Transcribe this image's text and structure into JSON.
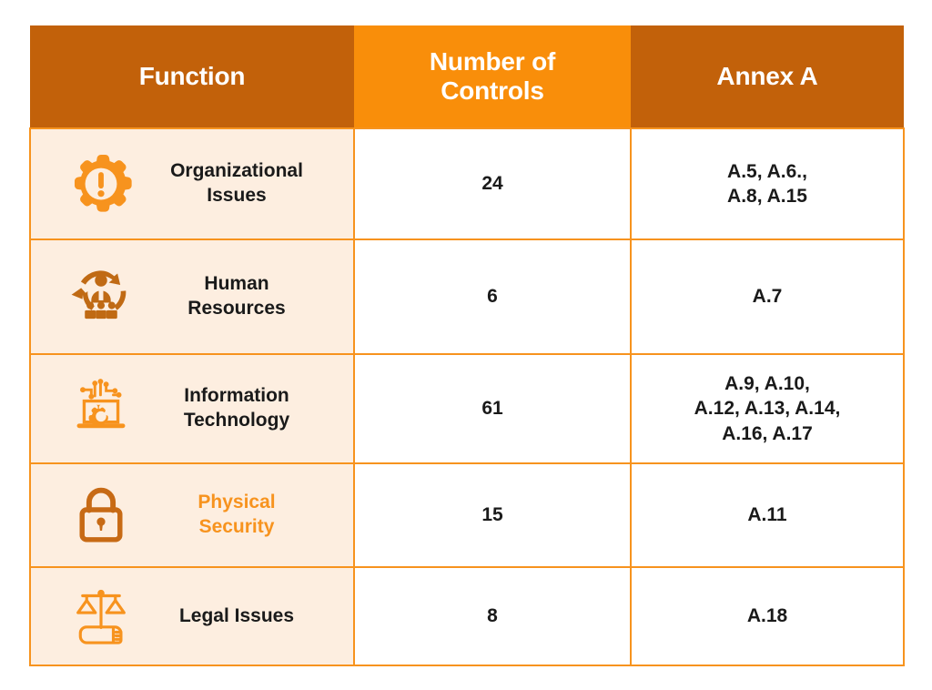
{
  "table": {
    "headers": [
      {
        "label": "Function",
        "bg": "#C2610A"
      },
      {
        "label": "Number of\nControls",
        "line1": "Number of",
        "line2": "Controls",
        "bg": "#F98E0A"
      },
      {
        "label": "Annex A",
        "bg": "#C2610A"
      }
    ],
    "rows": [
      {
        "icon": "gear-exclamation-icon",
        "icon_color": "#F7931E",
        "function_line1": "Organizational",
        "function_line2": "Issues",
        "function_accent": false,
        "controls": "24",
        "annex_lines": [
          "A.5, A.6.,",
          "A.8, A.15"
        ]
      },
      {
        "icon": "people-cycle-icon",
        "icon_color": "#C06A14",
        "function_line1": "Human",
        "function_line2": "Resources",
        "function_accent": false,
        "controls": "6",
        "annex_lines": [
          "A.7"
        ]
      },
      {
        "icon": "laptop-gear-circuit-icon",
        "icon_color": "#F7931E",
        "function_line1": "Information",
        "function_line2": "Technology",
        "function_accent": false,
        "controls": "61",
        "annex_lines": [
          "A.9, A.10,",
          "A.12, A.13, A.14,",
          "A.16, A.17"
        ]
      },
      {
        "icon": "padlock-icon",
        "icon_color": "#C76A15",
        "function_line1": "Physical",
        "function_line2": "Security",
        "function_accent": true,
        "controls": "15",
        "annex_lines": [
          "A.11"
        ]
      },
      {
        "icon": "scales-book-icon",
        "icon_color": "#F7931E",
        "function_line1": "Legal Issues",
        "function_line2": "",
        "function_accent": false,
        "controls": "8",
        "annex_lines": [
          "A.18"
        ]
      }
    ],
    "colors": {
      "header_dark": "#C2610A",
      "header_bright": "#F98E0A",
      "border": "#F7931E",
      "function_cell_bg": "#FDEEE0",
      "value_cell_bg": "#FFFFFF",
      "text_dark": "#1A1A1A",
      "accent_text": "#F7931E",
      "page_bg": "#FFFFFF"
    }
  }
}
